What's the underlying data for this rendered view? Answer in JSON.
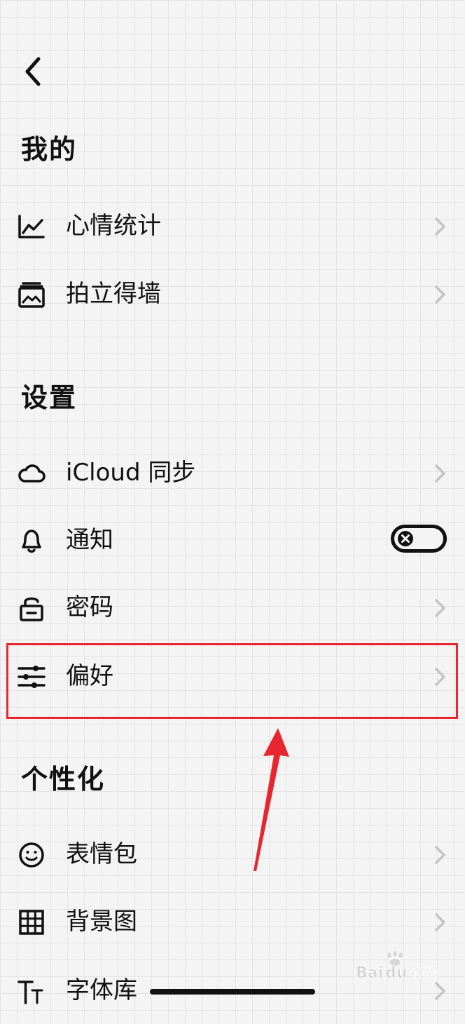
{
  "sections": {
    "mine": {
      "title": "我的",
      "items": [
        {
          "label": "心情统计",
          "icon": "chart-line-icon"
        },
        {
          "label": "拍立得墙",
          "icon": "photo-album-icon"
        }
      ]
    },
    "settings": {
      "title": "设置",
      "items": [
        {
          "label": "iCloud 同步",
          "icon": "cloud-icon"
        },
        {
          "label": "通知",
          "icon": "bell-icon",
          "toggle": "off"
        },
        {
          "label": "密码",
          "icon": "lock-icon"
        },
        {
          "label": "偏好",
          "icon": "sliders-icon"
        }
      ]
    },
    "personalize": {
      "title": "个性化",
      "items": [
        {
          "label": "表情包",
          "icon": "smiley-icon"
        },
        {
          "label": "背景图",
          "icon": "grid-icon"
        },
        {
          "label": "字体库",
          "icon": "font-icon"
        }
      ]
    }
  },
  "annotation": {
    "highlight_color": "#e8262f",
    "highlighted_item": "偏好"
  },
  "watermark": {
    "text": "Baidu 经验"
  },
  "colors": {
    "background": "#f4f4f4",
    "grid": "#e4e4e4",
    "text": "#111111",
    "chevron": "#c4c4c4"
  }
}
